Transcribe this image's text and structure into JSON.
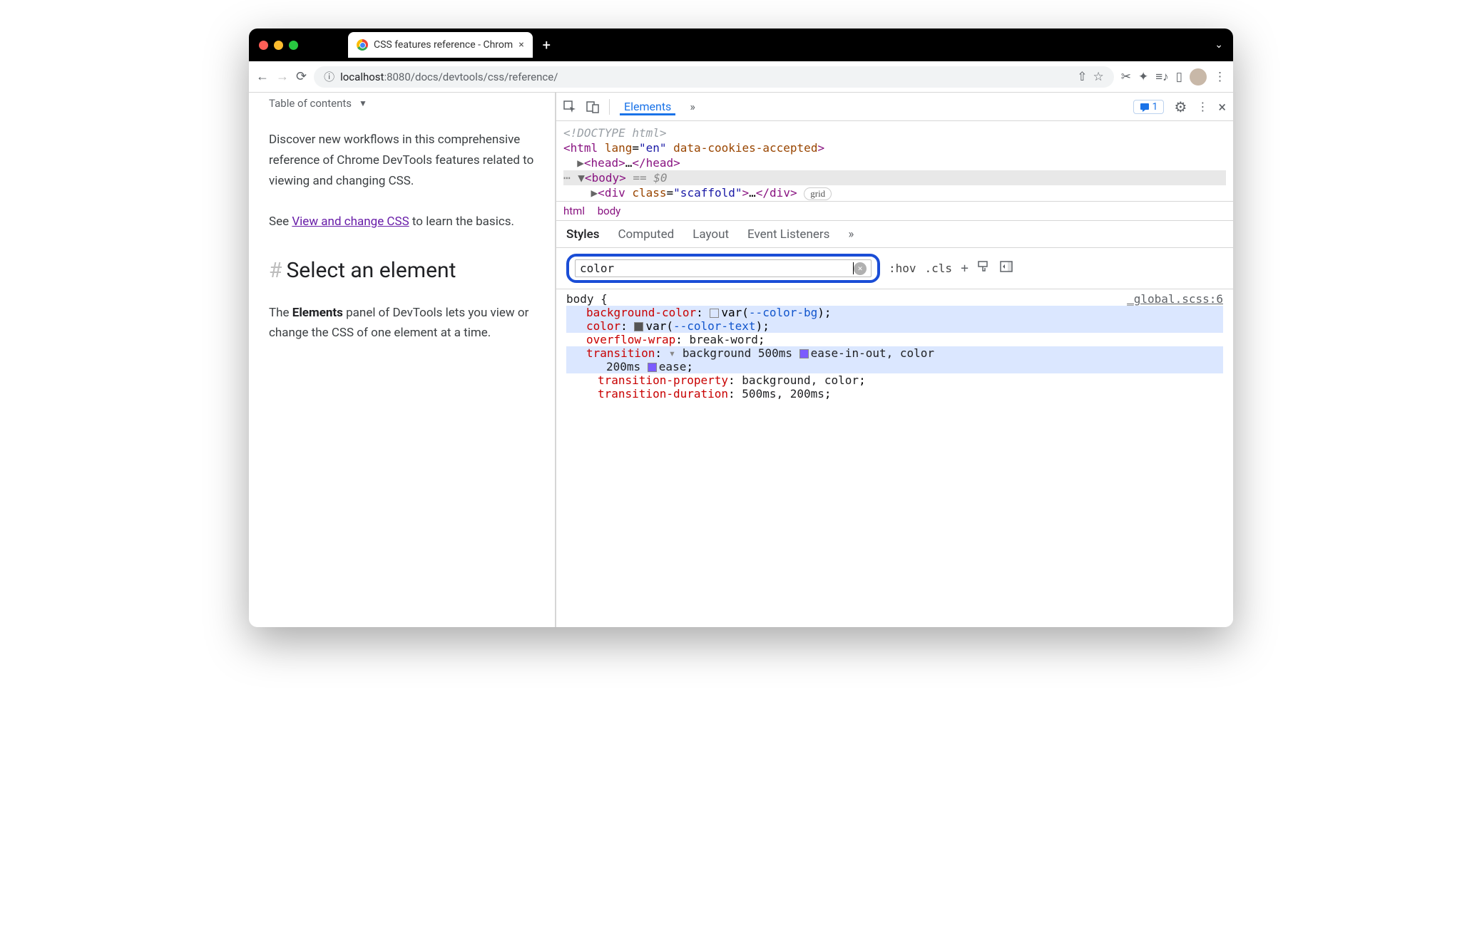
{
  "titlebar": {
    "tab_title": "CSS features reference - Chrom",
    "close": "×",
    "newtab": "+",
    "chevron": "⌄"
  },
  "urlbar": {
    "info": "ⓘ",
    "host": "localhost",
    "port": ":8080",
    "path": "/docs/devtools/css/reference/",
    "share": "⇧",
    "star": "☆",
    "scissors": "✂",
    "ext": "✦",
    "music": "≡♪",
    "reader": "▯",
    "menu": "⋮"
  },
  "page": {
    "toc": "Table of contents",
    "p1": "Discover new workflows in this comprehensive reference of Chrome DevTools features related to viewing and changing CSS.",
    "p2a": "See ",
    "p2link": "View and change CSS",
    "p2b": " to learn the basics.",
    "h2": "Select an element",
    "p3a": "The ",
    "p3bold": "Elements",
    "p3b": " panel of DevTools lets you view or change the CSS of one element at a time."
  },
  "dev": {
    "tabs": {
      "elements": "Elements",
      "more": "»"
    },
    "badge": "1",
    "gear": "⚙",
    "menu": "⋮",
    "close": "×",
    "dom": {
      "doctype": "<!DOCTYPE html>",
      "html_open": "<html lang=\"en\" data-cookies-accepted>",
      "head": "<head>…</head>",
      "body_open": "<body>",
      "body_sel": " == $0",
      "div": "<div class=\"scaffold\">…</div>",
      "grid": "grid"
    },
    "crumbs": {
      "a": "html",
      "b": "body"
    }
  },
  "styles": {
    "tabs": {
      "styles": "Styles",
      "computed": "Computed",
      "layout": "Layout",
      "events": "Event Listeners",
      "more": "»"
    },
    "filter": "color",
    "hov": ":hov",
    "cls": ".cls",
    "selector": "body {",
    "source": "_global.scss:6",
    "decls": {
      "bg_prop": "background-color",
      "bg_var": "--color-bg",
      "color_prop": "color",
      "color_var": "--color-text",
      "wrap_prop": "overflow-wrap",
      "wrap_val": "break-word",
      "trans_prop": "transition",
      "trans_val_a": "background 500ms ",
      "trans_val_b": "ease-in-out, color",
      "trans_val_c": "200ms ",
      "trans_val_d": "ease",
      "tp_prop": "transition-property",
      "tp_val": "background, color",
      "td_prop": "transition-duration",
      "td_val": "500ms, 200ms"
    }
  }
}
